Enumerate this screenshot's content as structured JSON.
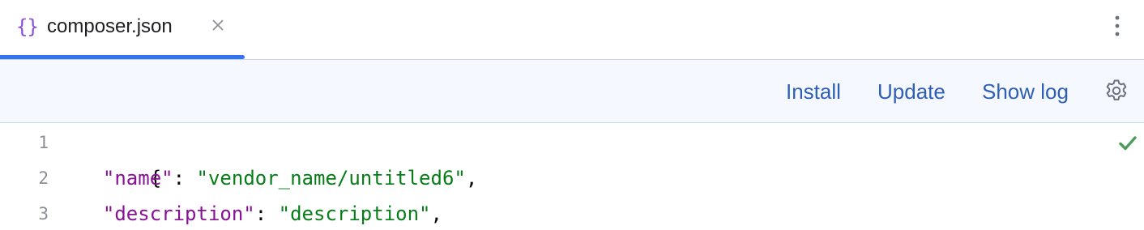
{
  "tab": {
    "icon": "{}",
    "icon_name": "json-braces-icon",
    "label": "composer.json",
    "active": true,
    "accent_color": "#3574f0"
  },
  "toolbar": {
    "install_label": "Install",
    "update_label": "Update",
    "show_log_label": "Show log",
    "link_color": "#2f5fb5"
  },
  "editor": {
    "lines": [
      {
        "number": "1",
        "text": "{"
      },
      {
        "number": "2",
        "key": "\"name\"",
        "sep": ": ",
        "value": "\"vendor_name/untitled6\"",
        "end": ","
      },
      {
        "number": "3",
        "key": "\"description\"",
        "sep": ": ",
        "value": "\"description\"",
        "end": ","
      }
    ],
    "key_color": "#871094",
    "string_color": "#067d17",
    "status_icon": "check-icon"
  }
}
